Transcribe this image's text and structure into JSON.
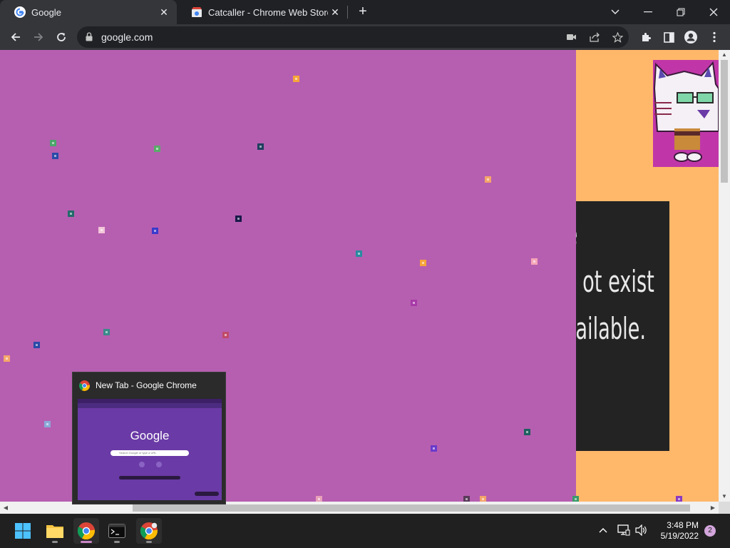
{
  "tabs": [
    {
      "title": "Google",
      "active": true,
      "icon": "google-g-icon"
    },
    {
      "title": "Catcaller - Chrome Web Store",
      "active": false,
      "icon": "chrome-web-store-icon"
    }
  ],
  "window_controls": {
    "tab_search": "chevron-down-icon",
    "minimize": "minimize-icon",
    "restore": "restore-icon",
    "close": "close-icon"
  },
  "address_bar": {
    "url": "google.com"
  },
  "page": {
    "background_color": "#b65fb0",
    "side_panel_color": "#ffb86a",
    "error_lines": [
      "e",
      "ot exist",
      "ailable."
    ]
  },
  "preview": {
    "title": "New Tab - Google Chrome",
    "thumbnail_logo": "Google",
    "thumbnail_search_placeholder": "Search Google or type a URL"
  },
  "taskbar": {
    "apps": [
      {
        "name": "start",
        "icon": "windows-start-icon"
      },
      {
        "name": "file-explorer",
        "icon": "folder-icon"
      },
      {
        "name": "chrome",
        "icon": "chrome-icon",
        "active": true
      },
      {
        "name": "terminal",
        "icon": "terminal-icon"
      },
      {
        "name": "chrome-profile",
        "icon": "chrome-icon"
      }
    ],
    "time": "3:48 PM",
    "date": "5/19/2022",
    "notification_count": "2"
  }
}
